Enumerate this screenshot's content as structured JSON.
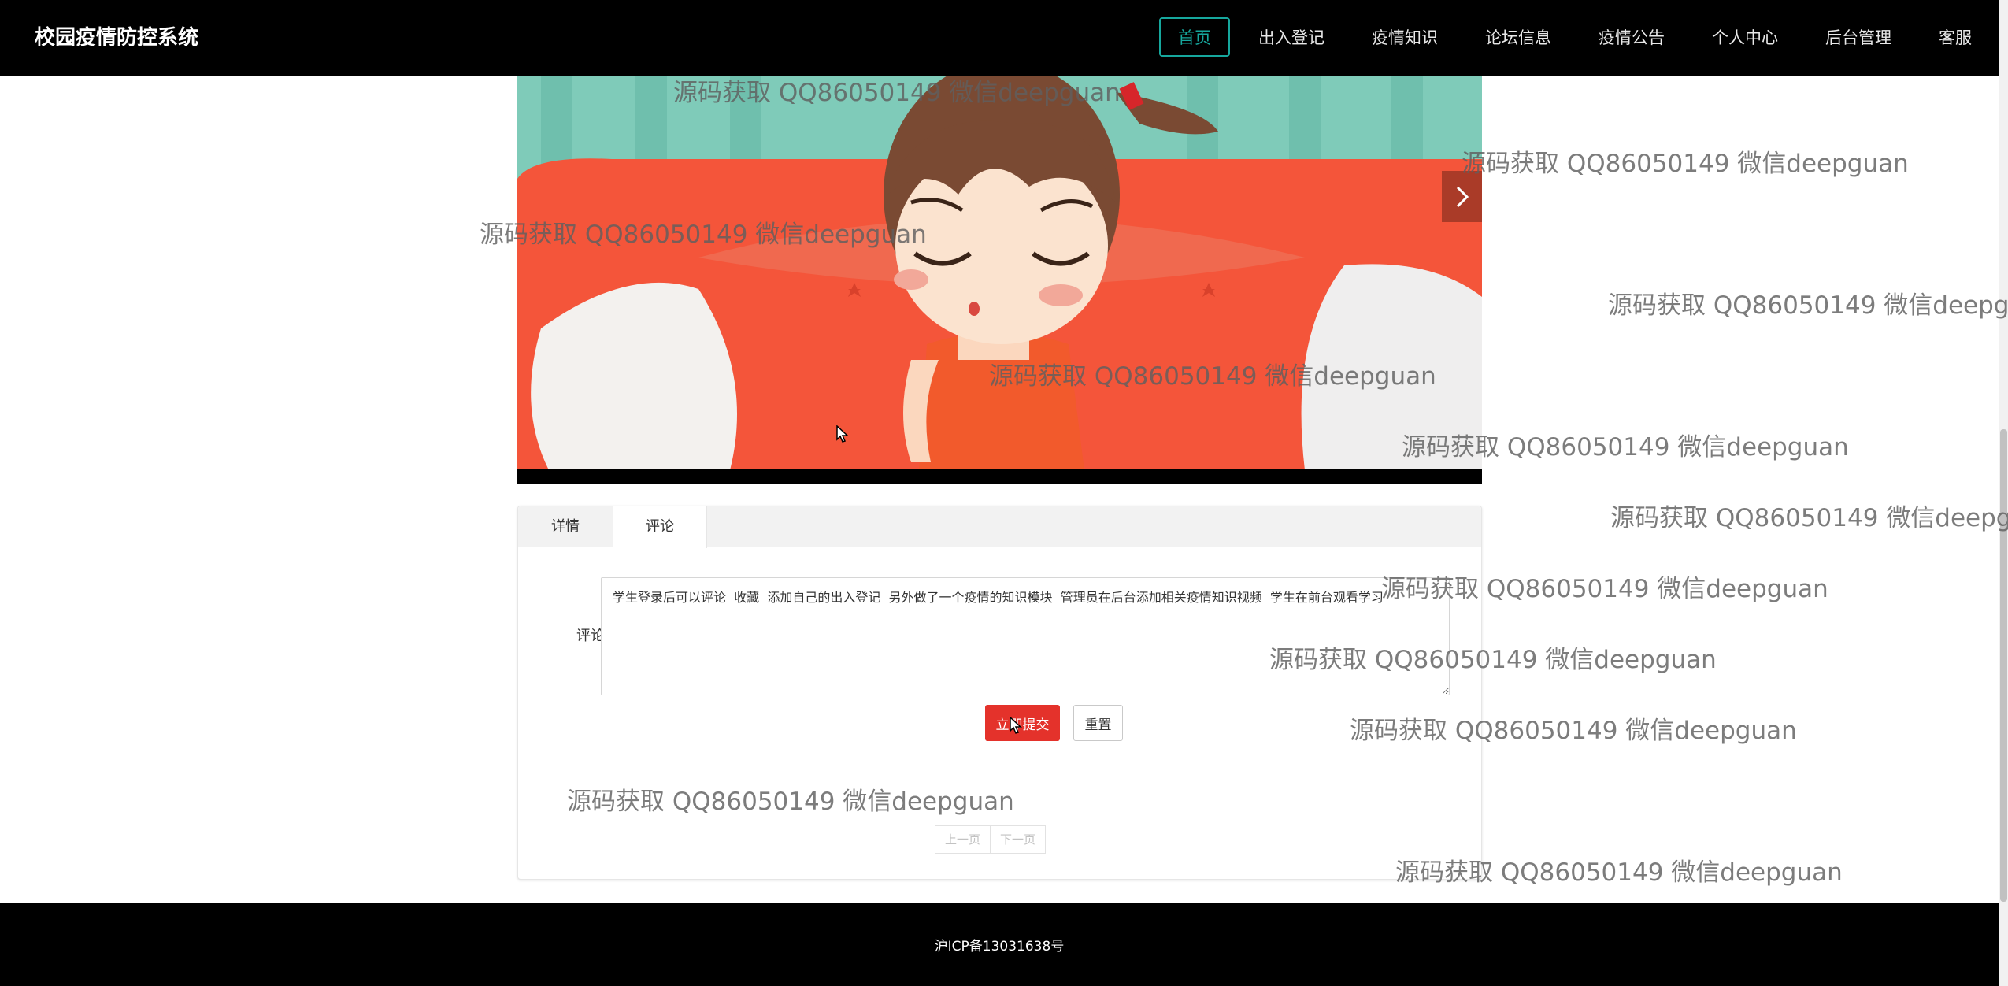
{
  "navbar": {
    "brand": "校园疫情防控系统",
    "items": [
      {
        "label": "首页",
        "active": true
      },
      {
        "label": "出入登记",
        "active": false
      },
      {
        "label": "疫情知识",
        "active": false
      },
      {
        "label": "论坛信息",
        "active": false
      },
      {
        "label": "疫情公告",
        "active": false
      },
      {
        "label": "个人中心",
        "active": false
      },
      {
        "label": "后台管理",
        "active": false
      },
      {
        "label": "客服",
        "active": false
      }
    ]
  },
  "tabs": [
    {
      "label": "详情",
      "active": false
    },
    {
      "label": "评论",
      "active": true
    }
  ],
  "comment_form": {
    "label": "评论",
    "value": "学生登录后可以评论  收藏  添加自己的出入登记  另外做了一个疫情的知识模块  管理员在后台添加相关疫情知识视频  学生在前台观看学习",
    "submit_label": "立即提交",
    "reset_label": "重置"
  },
  "pager": {
    "prev_label": "上一页",
    "next_label": "下一页"
  },
  "footer": {
    "icp": "沪ICP备13031638号"
  },
  "watermark": {
    "text": "源码获取 QQ86050149 微信deepguan"
  },
  "colors": {
    "nav_active": "#16a79d",
    "submit_button": "#e4322b",
    "navbar_bg": "#000000"
  }
}
